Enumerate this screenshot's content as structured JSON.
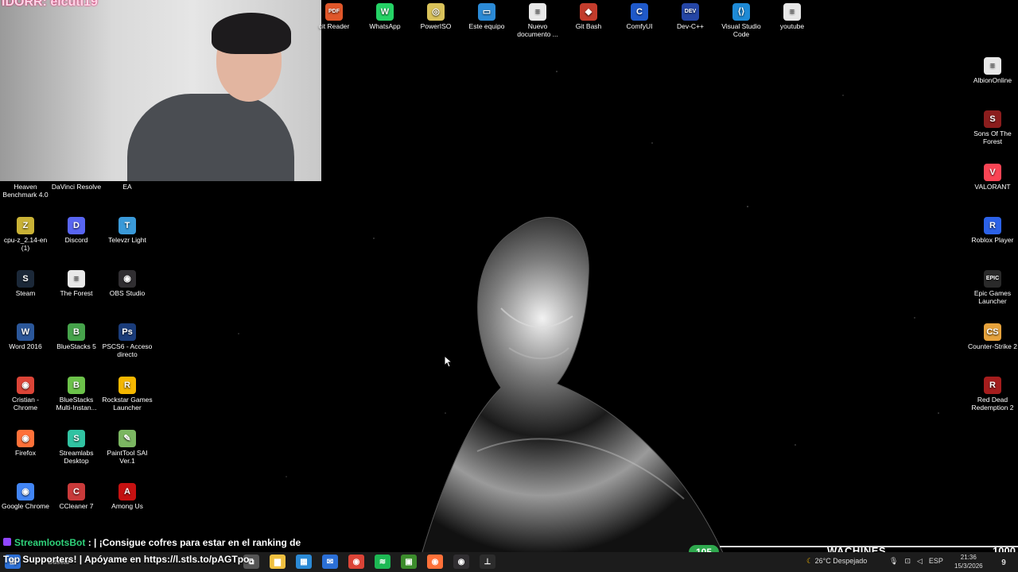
{
  "stream_overlay": {
    "username": "IDORR: elcuti19",
    "chat_bot": "StreamlootsBot",
    "chat_separator": ":",
    "chat_message": "| ¡Consigue cofres para estar en el ranking de",
    "supporters_text": "Top Supporters! | Apóyame en https://l.stls.to/pAGTpo",
    "goal_count": "105",
    "brand": "WACHINES",
    "counter": "1000"
  },
  "desktop": {
    "top_icons": [
      {
        "label": "cit Reader",
        "color": "#e0572a",
        "glyph": "PDF"
      },
      {
        "label": "WhatsApp",
        "color": "#25d366",
        "glyph": "W"
      },
      {
        "label": "PowerISO",
        "color": "#d9c25a",
        "glyph": "◎"
      },
      {
        "label": "Este equipo",
        "color": "#2b8ad6",
        "glyph": "▭"
      },
      {
        "label": "Nuevo documento ...",
        "color": "#e8e8e8",
        "glyph": "≡"
      },
      {
        "label": "Git Bash",
        "color": "#c43c2c",
        "glyph": "◆"
      },
      {
        "label": "ComfyUI",
        "color": "#1f59c9",
        "glyph": "C"
      },
      {
        "label": "Dev-C++",
        "color": "#2546a5",
        "glyph": "DEV"
      },
      {
        "label": "Visual Studio Code",
        "color": "#1e8ad6",
        "glyph": "⟨⟩"
      },
      {
        "label": "youtube",
        "color": "#e8e8e8",
        "glyph": "≡"
      }
    ],
    "left_icons": [
      {
        "label": "Heaven Benchmark 4.0",
        "color": "#444",
        "glyph": ""
      },
      {
        "label": "DaVinci Resolve",
        "color": "#444",
        "glyph": ""
      },
      {
        "label": "EA",
        "color": "#444",
        "glyph": ""
      },
      {
        "label": "cpu-z_2.14-en (1)",
        "color": "#c9b236",
        "glyph": "Z"
      },
      {
        "label": "Discord",
        "color": "#5865f2",
        "glyph": "D"
      },
      {
        "label": "Televzr Light",
        "color": "#3a9ad9",
        "glyph": "T"
      },
      {
        "label": "Steam",
        "color": "#1b2838",
        "glyph": "S"
      },
      {
        "label": "The Forest",
        "color": "#e8e8e8",
        "glyph": "≡"
      },
      {
        "label": "OBS Studio",
        "color": "#302e31",
        "glyph": "◉"
      },
      {
        "label": "Word 2016",
        "color": "#2b579a",
        "glyph": "W"
      },
      {
        "label": "BlueStacks 5",
        "color": "#46a34b",
        "glyph": "B"
      },
      {
        "label": "PSCS6 - Acceso directo",
        "color": "#1a3c7a",
        "glyph": "Ps"
      },
      {
        "label": "Cristian - Chrome",
        "color": "#db4437",
        "glyph": "◉"
      },
      {
        "label": "BlueStacks Multi-Instan...",
        "color": "#6cc24a",
        "glyph": "B"
      },
      {
        "label": "Rockstar Games Launcher",
        "color": "#f5b700",
        "glyph": "R"
      },
      {
        "label": "Firefox",
        "color": "#ff7139",
        "glyph": "◉"
      },
      {
        "label": "Streamlabs Desktop",
        "color": "#31c3a2",
        "glyph": "S"
      },
      {
        "label": "PaintTool SAI Ver.1",
        "color": "#7bb661",
        "glyph": "✎"
      },
      {
        "label": "Google Chrome",
        "color": "#4285f4",
        "glyph": "◉"
      },
      {
        "label": "CCleaner 7",
        "color": "#c93a3a",
        "glyph": "C"
      },
      {
        "label": "Among Us",
        "color": "#c51111",
        "glyph": "A"
      }
    ],
    "right_icons": [
      {
        "label": "AlbionOnline",
        "color": "#e8e8e8",
        "glyph": "≡"
      },
      {
        "label": "Sons Of The Forest",
        "color": "#8b1d1d",
        "glyph": "S"
      },
      {
        "label": "VALORANT",
        "color": "#fa4454",
        "glyph": "V"
      },
      {
        "label": "Roblox Player",
        "color": "#2c62e8",
        "glyph": "R"
      },
      {
        "label": "Epic Games Launcher",
        "color": "#2a2a2a",
        "glyph": "EPIC"
      },
      {
        "label": "Counter-Strike 2",
        "color": "#e6a23c",
        "glyph": "CS"
      },
      {
        "label": "Red Dead Redemption 2",
        "color": "#a51d1d",
        "glyph": "R"
      }
    ]
  },
  "taskbar": {
    "search_label": "Buscar",
    "apps": [
      {
        "name": "task-view",
        "color": "#555",
        "glyph": "⧉"
      },
      {
        "name": "file-explorer",
        "color": "#f0c040",
        "glyph": "▆"
      },
      {
        "name": "store",
        "color": "#2b8ad6",
        "glyph": "▦"
      },
      {
        "name": "mail",
        "color": "#2b6fd6",
        "glyph": "✉"
      },
      {
        "name": "chrome",
        "color": "#db4437",
        "glyph": "◉"
      },
      {
        "name": "spotify",
        "color": "#1db954",
        "glyph": "≋"
      },
      {
        "name": "minecraft",
        "color": "#3c8c2c",
        "glyph": "▣"
      },
      {
        "name": "firefox",
        "color": "#ff7139",
        "glyph": "◉"
      },
      {
        "name": "obs",
        "color": "#302e31",
        "glyph": "◉"
      },
      {
        "name": "terminal",
        "color": "#2c2c2c",
        "glyph": "⊥"
      }
    ],
    "weather": "26°C  Despejado",
    "language": "ESP",
    "time": "21:36",
    "date": "15/3/2026",
    "notifications": "9"
  }
}
